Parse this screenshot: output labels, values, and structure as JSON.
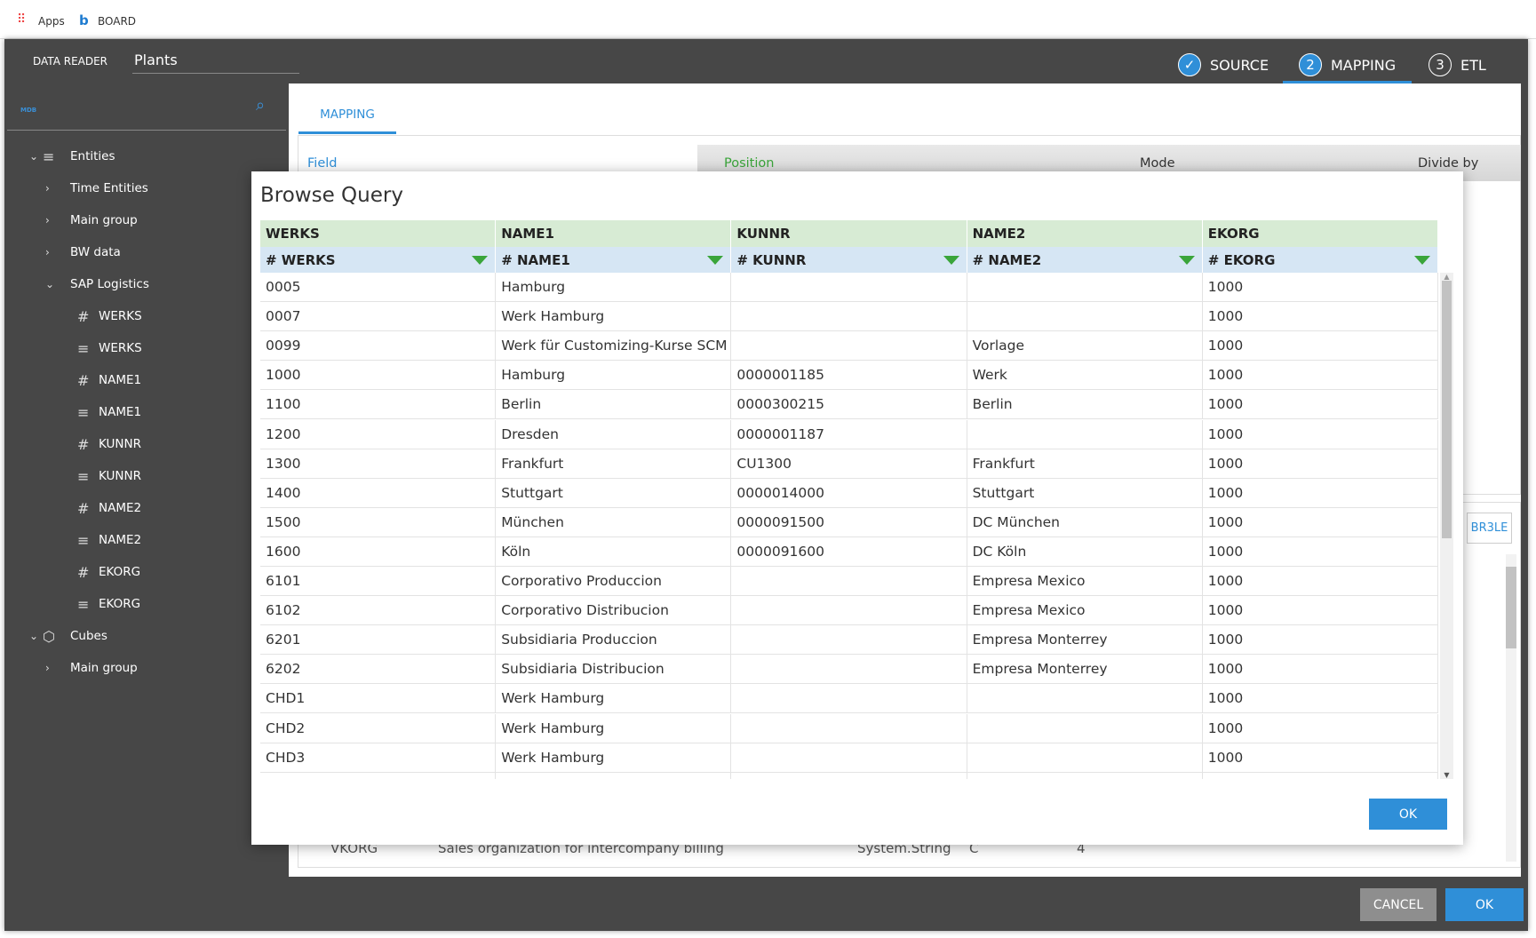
{
  "browser": {
    "apps_label": "Apps",
    "board_label": "BOARD"
  },
  "header": {
    "section": "DATA READER",
    "title": "Plants",
    "steps": [
      {
        "num": "✓",
        "label": "SOURCE"
      },
      {
        "num": "2",
        "label": "MAPPING"
      },
      {
        "num": "3",
        "label": "ETL"
      }
    ],
    "active_step": "MAPPING"
  },
  "sidebar": {
    "db_label": "MDB",
    "items": [
      {
        "label": "Entities",
        "chev": "⌄",
        "icon": "≡",
        "level": 0
      },
      {
        "label": "Time Entities",
        "chev": "›",
        "level": 1
      },
      {
        "label": "Main group",
        "chev": "›",
        "level": 1
      },
      {
        "label": "BW data",
        "chev": "›",
        "level": 1
      },
      {
        "label": "SAP Logistics",
        "chev": "⌄",
        "level": 1
      },
      {
        "label": "WERKS",
        "icon": "#",
        "level": 2
      },
      {
        "label": "WERKS",
        "icon": "≡",
        "level": 2
      },
      {
        "label": "NAME1",
        "icon": "#",
        "level": 2
      },
      {
        "label": "NAME1",
        "icon": "≡",
        "level": 2
      },
      {
        "label": "KUNNR",
        "icon": "#",
        "level": 2
      },
      {
        "label": "KUNNR",
        "icon": "≡",
        "level": 2
      },
      {
        "label": "NAME2",
        "icon": "#",
        "level": 2
      },
      {
        "label": "NAME2",
        "icon": "≡",
        "level": 2
      },
      {
        "label": "EKORG",
        "icon": "#",
        "level": 2
      },
      {
        "label": "EKORG",
        "icon": "≡",
        "level": 2
      },
      {
        "label": "Cubes",
        "chev": "⌄",
        "icon": "⬡",
        "level": 0
      },
      {
        "label": "Main group",
        "chev": "›",
        "level": 1
      }
    ]
  },
  "main": {
    "tab": "MAPPING",
    "columns": {
      "field": "Field",
      "position": "Position",
      "mode": "Mode",
      "divide": "Divide by"
    },
    "button_partial": "BR3LE",
    "bg_row": [
      "VKORG",
      "Sales organization for intercompany billing",
      "System.String",
      "C",
      "4"
    ]
  },
  "modal": {
    "title": "Browse Query",
    "ok": "OK",
    "headers": [
      "WERKS",
      "NAME1",
      "KUNNR",
      "NAME2",
      "EKORG"
    ],
    "subheaders": [
      "# WERKS",
      "# NAME1",
      "# KUNNR",
      "# NAME2",
      "# EKORG"
    ],
    "rows": [
      [
        "0005",
        "Hamburg",
        "",
        "",
        "1000"
      ],
      [
        "0007",
        "Werk Hamburg",
        "",
        "",
        "1000"
      ],
      [
        "0099",
        "Werk für Customizing-Kurse SCM",
        "",
        "Vorlage",
        "1000"
      ],
      [
        "1000",
        "Hamburg",
        "0000001185",
        "Werk",
        "1000"
      ],
      [
        "1100",
        "Berlin",
        "0000300215",
        "Berlin",
        "1000"
      ],
      [
        "1200",
        "Dresden",
        "0000001187",
        "",
        "1000"
      ],
      [
        "1300",
        "Frankfurt",
        "CU1300",
        "Frankfurt",
        "1000"
      ],
      [
        "1400",
        "Stuttgart",
        "0000014000",
        "Stuttgart",
        "1000"
      ],
      [
        "1500",
        "München",
        "0000091500",
        "DC München",
        "1000"
      ],
      [
        "1600",
        "Köln",
        "0000091600",
        "DC Köln",
        "1000"
      ],
      [
        "6101",
        "Corporativo Produccion",
        "",
        "Empresa Mexico",
        "1000"
      ],
      [
        "6102",
        "Corporativo Distribucion",
        "",
        "Empresa Mexico",
        "1000"
      ],
      [
        "6201",
        "Subsidiaria Produccion",
        "",
        "Empresa Monterrey",
        "1000"
      ],
      [
        "6202",
        "Subsidiaria Distribucion",
        "",
        "Empresa Monterrey",
        "1000"
      ],
      [
        "CHD1",
        "Werk Hamburg",
        "",
        "",
        "1000"
      ],
      [
        "CHD2",
        "Werk Hamburg",
        "",
        "",
        "1000"
      ],
      [
        "CHD3",
        "Werk Hamburg",
        "",
        "",
        "1000"
      ]
    ]
  },
  "footer": {
    "cancel": "CANCEL",
    "ok": "OK"
  },
  "colors": {
    "accent": "#2f8fd8",
    "header_bg": "#474747",
    "green_header": "#d7ebd4",
    "blue_header": "#d6e6f4",
    "triangle": "#3aa53a"
  }
}
